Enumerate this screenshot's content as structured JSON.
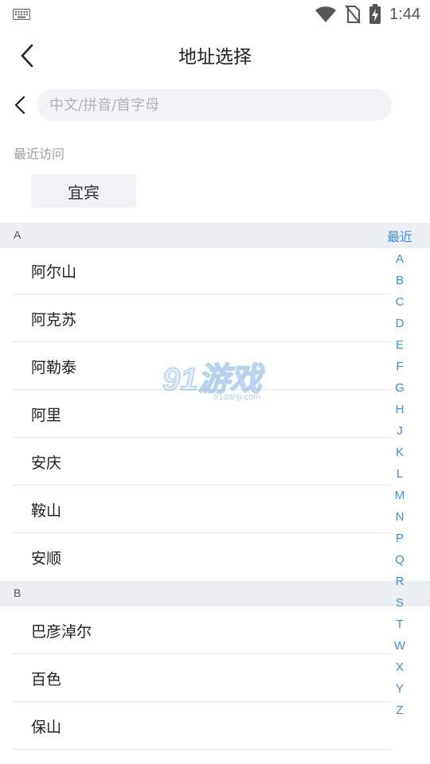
{
  "status_bar": {
    "time": "1:44",
    "icons": [
      "keyboard-icon",
      "wifi-icon",
      "no-sim-icon",
      "battery-charging-icon"
    ]
  },
  "header": {
    "title": "地址选择",
    "back_icon": "chevron-left-icon"
  },
  "search": {
    "placeholder": "中文/拼音/首字母",
    "value": "",
    "back_icon": "chevron-left-icon"
  },
  "recent": {
    "label": "最近访问",
    "items": [
      "宜宾"
    ]
  },
  "sections": [
    {
      "letter": "A",
      "cities": [
        "阿尔山",
        "阿克苏",
        "阿勒泰",
        "阿里",
        "安庆",
        "鞍山",
        "安顺"
      ]
    },
    {
      "letter": "B",
      "cities": [
        "巴彦淖尔",
        "百色",
        "保山"
      ]
    }
  ],
  "alphabet_index": [
    "最近",
    "A",
    "B",
    "C",
    "D",
    "E",
    "F",
    "G",
    "H",
    "J",
    "K",
    "L",
    "M",
    "N",
    "P",
    "Q",
    "R",
    "S",
    "T",
    "W",
    "X",
    "Y",
    "Z"
  ],
  "watermark": {
    "text": "91游戏",
    "subtext": "91danji.com"
  },
  "colors": {
    "accent": "#3a8ee6",
    "section_bg": "#eceef1",
    "search_bg": "#f1f3f6"
  }
}
